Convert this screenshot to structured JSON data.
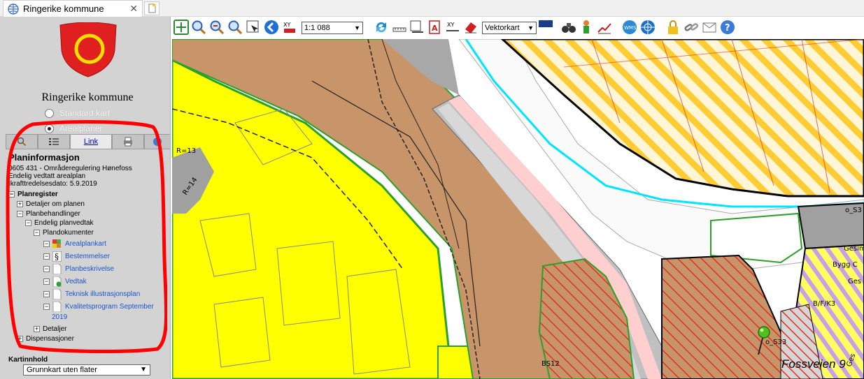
{
  "browser": {
    "tab_title": "Ringerike kommune"
  },
  "sidebar": {
    "kommune_name": "Ringerike kommune",
    "radio_options": [
      {
        "label": "Standard kart",
        "selected": false
      },
      {
        "label": "Arealplaner",
        "selected": true
      }
    ],
    "panel_tabs": {
      "link_label": "Link"
    },
    "planinfo": {
      "title": "Planinformasjon",
      "line1": "0605 431 - Områderegulering Hønefoss",
      "line2": "Endelig vedtatt arealplan",
      "line3": "Ikrafttredelsesdato: 5.9.2019"
    },
    "tree": {
      "planregister": "Planregister",
      "detaljer_om_planen": "Detaljer om planen",
      "planbehandlinger": "Planbehandlinger",
      "endelig_planvedtak": "Endelig planvedtak",
      "plandokumenter": "Plandokumenter",
      "docs": [
        "Arealplankart",
        "Bestemmelser",
        "Planbeskrivelse",
        "Vedtak",
        "Teknisk illustrasjonsplan",
        "Kvalitetsprogram September",
        "2019"
      ],
      "detaljer": "Detaljer",
      "dispensasjoner": "Dispensasjoner"
    },
    "kartinnhold": {
      "label": "Kartinnhold",
      "selected": "Grunnkart uten flater"
    }
  },
  "toolbar": {
    "scale": "1:1 088",
    "map_type": "Vektorkart"
  },
  "map": {
    "labels": {
      "r13": "R=13",
      "r14": "R=14",
      "os3": "o_S3",
      "gesims": "Gesims",
      "byggc": "Bygg C",
      "ges": "Ges",
      "bfk3": "B/F/K3",
      "os33": "o_S33",
      "bs12": "BS12",
      "ges2": "Ges"
    },
    "address": "Fossveien 9"
  },
  "colors": {
    "yellow_zone": "#ffff00",
    "brown_zone": "#c8956a",
    "road_gray": "#c0c0c0",
    "hatch_orange": "#ffcc33",
    "hatch_red": "#e03020",
    "cyan_line": "#00e5ff",
    "green_border": "#2aa02a",
    "annotation_red": "#ff0000"
  }
}
